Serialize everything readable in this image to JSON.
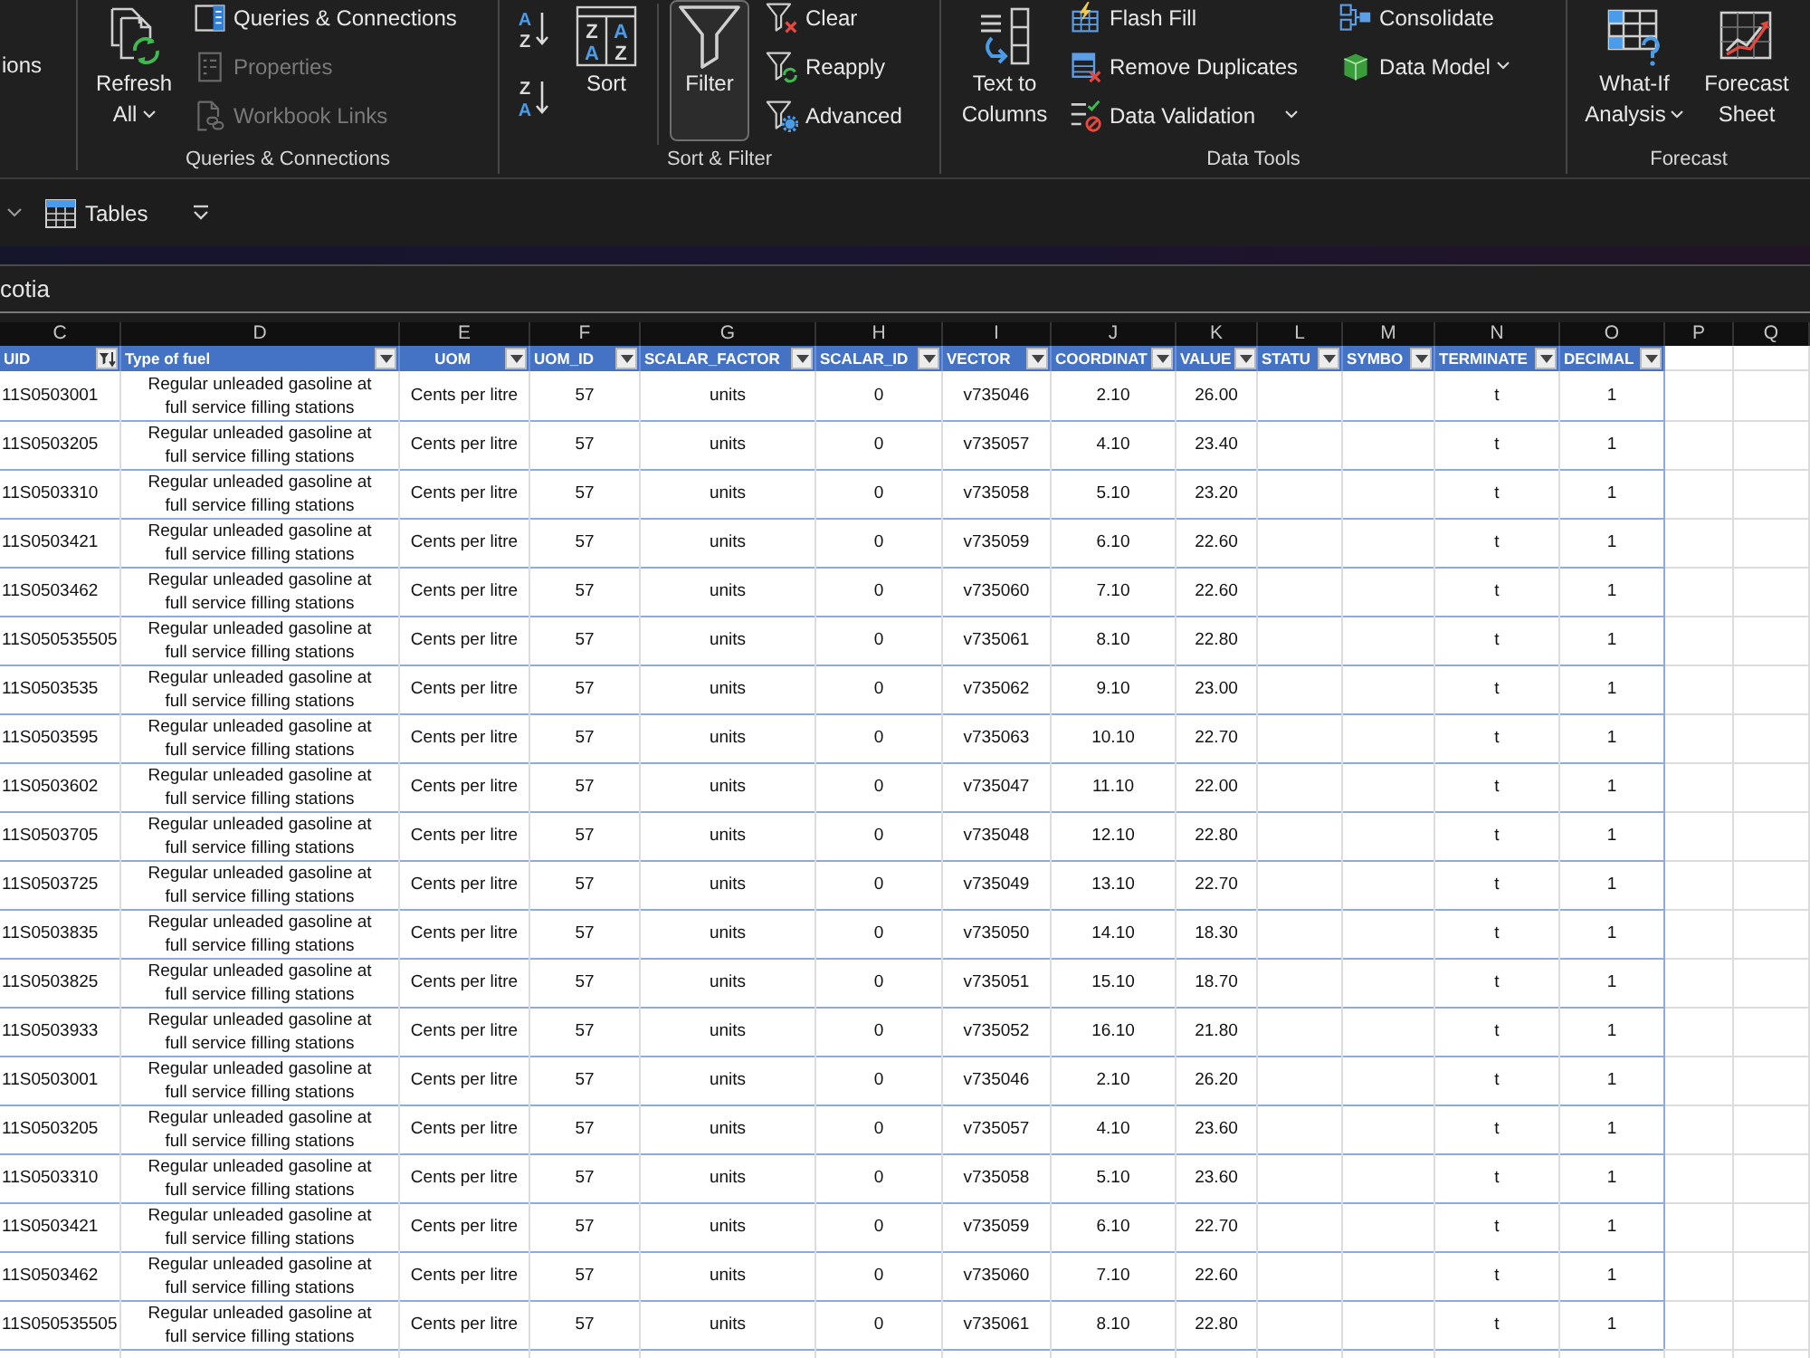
{
  "ribbon": {
    "cut_button": {
      "label": "ions"
    },
    "groups": [
      {
        "label": "Queries & Connections",
        "columns": [
          {
            "kind": "large",
            "buttons": [
              {
                "label": "Refresh All",
                "dropdown": true,
                "on": false
              }
            ]
          },
          {
            "kind": "stack",
            "buttons": [
              {
                "label": "Queries & Connections",
                "dropdown": false,
                "disabled": false
              },
              {
                "label": "Properties",
                "dropdown": false,
                "disabled": true
              },
              {
                "label": "Workbook Links",
                "dropdown": false,
                "disabled": true
              }
            ]
          }
        ]
      },
      {
        "label": "Sort & Filter",
        "columns": [
          {
            "kind": "icons",
            "buttons": [
              {
                "letters": [
                  "A",
                  "Z"
                ]
              },
              {
                "letters": [
                  "Z",
                  "A"
                ]
              }
            ]
          },
          {
            "kind": "large",
            "buttons": [
              {
                "label": "Sort",
                "letters": [
                  "Z",
                  "A",
                  "A",
                  "Z"
                ],
                "dropdown": false,
                "on": false
              }
            ]
          },
          {
            "kind": "large",
            "buttons": [
              {
                "label": "Filter",
                "dropdown": false,
                "on": true
              }
            ]
          },
          {
            "kind": "stack",
            "buttons": [
              {
                "label": "Clear",
                "dropdown": false,
                "disabled": false
              },
              {
                "label": "Reapply",
                "dropdown": false,
                "disabled": false
              },
              {
                "label": "Advanced",
                "dropdown": false,
                "disabled": false
              }
            ]
          }
        ]
      },
      {
        "label": "Data Tools",
        "columns": [
          {
            "kind": "large",
            "buttons": [
              {
                "label": "Text to Columns",
                "dropdown": false,
                "on": false
              }
            ]
          },
          {
            "kind": "stack",
            "buttons": [
              {
                "label": "Flash Fill",
                "dropdown": false,
                "disabled": false
              },
              {
                "label": "Remove Duplicates",
                "dropdown": false,
                "disabled": false
              },
              {
                "label": "Data Validation",
                "dropdown": true,
                "disabled": false
              }
            ]
          },
          {
            "kind": "stack",
            "buttons": [
              {
                "label": "Consolidate",
                "dropdown": false,
                "disabled": false
              },
              {
                "label": "Data Model",
                "dropdown": true,
                "disabled": false
              }
            ]
          }
        ]
      },
      {
        "label": "Forecast",
        "columns": [
          {
            "kind": "large",
            "buttons": [
              {
                "label": "What-If Analysis",
                "dropdown": true,
                "on": false
              },
              {
                "label": "Forecast Sheet",
                "dropdown": false,
                "on": false
              }
            ]
          }
        ]
      }
    ]
  },
  "toolbar": {
    "tables_button": {
      "label": "Tables"
    }
  },
  "formula_bar": {
    "value": "cotia"
  },
  "sheet": {
    "column_letters": [
      "C",
      "D",
      "E",
      "F",
      "G",
      "H",
      "I",
      "J",
      "K",
      "L",
      "M",
      "N",
      "O",
      "P",
      "Q"
    ],
    "table": {
      "columns": [
        {
          "heading": "UID",
          "filter_applied": true
        },
        {
          "heading": "Type of fuel",
          "filter_applied": false
        },
        {
          "heading": "UOM",
          "filter_applied": false
        },
        {
          "heading": "UOM_ID",
          "filter_applied": false
        },
        {
          "heading": "SCALAR_FACTOR",
          "filter_applied": false
        },
        {
          "heading": "SCALAR_ID",
          "filter_applied": false
        },
        {
          "heading": "VECTOR",
          "filter_applied": false
        },
        {
          "heading": "COORDINAT",
          "filter_applied": false
        },
        {
          "heading": "VALUE",
          "filter_applied": false
        },
        {
          "heading": "STATU",
          "filter_applied": false
        },
        {
          "heading": "SYMBO",
          "filter_applied": false
        },
        {
          "heading": "TERMINATE",
          "filter_applied": false
        },
        {
          "heading": "DECIMAL",
          "filter_applied": false
        }
      ],
      "rows": [
        {
          "uid": "11S0503001",
          "type_of_fuel": "Regular unleaded gasoline at full service filling stations",
          "uom": "Cents per litre",
          "uom_id": "57",
          "scalar_factor": "units",
          "scalar_id": "0",
          "vector": "v735046",
          "coordinate": "2.10",
          "value": "26.00",
          "terminated": "t",
          "decimals": "1"
        },
        {
          "uid": "11S0503205",
          "type_of_fuel": "Regular unleaded gasoline at full service filling stations",
          "uom": "Cents per litre",
          "uom_id": "57",
          "scalar_factor": "units",
          "scalar_id": "0",
          "vector": "v735057",
          "coordinate": "4.10",
          "value": "23.40",
          "terminated": "t",
          "decimals": "1"
        },
        {
          "uid": "11S0503310",
          "type_of_fuel": "Regular unleaded gasoline at full service filling stations",
          "uom": "Cents per litre",
          "uom_id": "57",
          "scalar_factor": "units",
          "scalar_id": "0",
          "vector": "v735058",
          "coordinate": "5.10",
          "value": "23.20",
          "terminated": "t",
          "decimals": "1"
        },
        {
          "uid": "11S0503421",
          "type_of_fuel": "Regular unleaded gasoline at full service filling stations",
          "uom": "Cents per litre",
          "uom_id": "57",
          "scalar_factor": "units",
          "scalar_id": "0",
          "vector": "v735059",
          "coordinate": "6.10",
          "value": "22.60",
          "terminated": "t",
          "decimals": "1"
        },
        {
          "uid": "11S0503462",
          "type_of_fuel": "Regular unleaded gasoline at full service filling stations",
          "uom": "Cents per litre",
          "uom_id": "57",
          "scalar_factor": "units",
          "scalar_id": "0",
          "vector": "v735060",
          "coordinate": "7.10",
          "value": "22.60",
          "terminated": "t",
          "decimals": "1"
        },
        {
          "uid": "11S050535505",
          "type_of_fuel": "Regular unleaded gasoline at full service filling stations",
          "uom": "Cents per litre",
          "uom_id": "57",
          "scalar_factor": "units",
          "scalar_id": "0",
          "vector": "v735061",
          "coordinate": "8.10",
          "value": "22.80",
          "terminated": "t",
          "decimals": "1"
        },
        {
          "uid": "11S0503535",
          "type_of_fuel": "Regular unleaded gasoline at full service filling stations",
          "uom": "Cents per litre",
          "uom_id": "57",
          "scalar_factor": "units",
          "scalar_id": "0",
          "vector": "v735062",
          "coordinate": "9.10",
          "value": "23.00",
          "terminated": "t",
          "decimals": "1"
        },
        {
          "uid": "11S0503595",
          "type_of_fuel": "Regular unleaded gasoline at full service filling stations",
          "uom": "Cents per litre",
          "uom_id": "57",
          "scalar_factor": "units",
          "scalar_id": "0",
          "vector": "v735063",
          "coordinate": "10.10",
          "value": "22.70",
          "terminated": "t",
          "decimals": "1"
        },
        {
          "uid": "11S0503602",
          "type_of_fuel": "Regular unleaded gasoline at full service filling stations",
          "uom": "Cents per litre",
          "uom_id": "57",
          "scalar_factor": "units",
          "scalar_id": "0",
          "vector": "v735047",
          "coordinate": "11.10",
          "value": "22.00",
          "terminated": "t",
          "decimals": "1"
        },
        {
          "uid": "11S0503705",
          "type_of_fuel": "Regular unleaded gasoline at full service filling stations",
          "uom": "Cents per litre",
          "uom_id": "57",
          "scalar_factor": "units",
          "scalar_id": "0",
          "vector": "v735048",
          "coordinate": "12.10",
          "value": "22.80",
          "terminated": "t",
          "decimals": "1"
        },
        {
          "uid": "11S0503725",
          "type_of_fuel": "Regular unleaded gasoline at full service filling stations",
          "uom": "Cents per litre",
          "uom_id": "57",
          "scalar_factor": "units",
          "scalar_id": "0",
          "vector": "v735049",
          "coordinate": "13.10",
          "value": "22.70",
          "terminated": "t",
          "decimals": "1"
        },
        {
          "uid": "11S0503835",
          "type_of_fuel": "Regular unleaded gasoline at full service filling stations",
          "uom": "Cents per litre",
          "uom_id": "57",
          "scalar_factor": "units",
          "scalar_id": "0",
          "vector": "v735050",
          "coordinate": "14.10",
          "value": "18.30",
          "terminated": "t",
          "decimals": "1"
        },
        {
          "uid": "11S0503825",
          "type_of_fuel": "Regular unleaded gasoline at full service filling stations",
          "uom": "Cents per litre",
          "uom_id": "57",
          "scalar_factor": "units",
          "scalar_id": "0",
          "vector": "v735051",
          "coordinate": "15.10",
          "value": "18.70",
          "terminated": "t",
          "decimals": "1"
        },
        {
          "uid": "11S0503933",
          "type_of_fuel": "Regular unleaded gasoline at full service filling stations",
          "uom": "Cents per litre",
          "uom_id": "57",
          "scalar_factor": "units",
          "scalar_id": "0",
          "vector": "v735052",
          "coordinate": "16.10",
          "value": "21.80",
          "terminated": "t",
          "decimals": "1"
        },
        {
          "uid": "11S0503001",
          "type_of_fuel": "Regular unleaded gasoline at full service filling stations",
          "uom": "Cents per litre",
          "uom_id": "57",
          "scalar_factor": "units",
          "scalar_id": "0",
          "vector": "v735046",
          "coordinate": "2.10",
          "value": "26.20",
          "terminated": "t",
          "decimals": "1"
        },
        {
          "uid": "11S0503205",
          "type_of_fuel": "Regular unleaded gasoline at full service filling stations",
          "uom": "Cents per litre",
          "uom_id": "57",
          "scalar_factor": "units",
          "scalar_id": "0",
          "vector": "v735057",
          "coordinate": "4.10",
          "value": "23.60",
          "terminated": "t",
          "decimals": "1"
        },
        {
          "uid": "11S0503310",
          "type_of_fuel": "Regular unleaded gasoline at full service filling stations",
          "uom": "Cents per litre",
          "uom_id": "57",
          "scalar_factor": "units",
          "scalar_id": "0",
          "vector": "v735058",
          "coordinate": "5.10",
          "value": "23.60",
          "terminated": "t",
          "decimals": "1"
        },
        {
          "uid": "11S0503421",
          "type_of_fuel": "Regular unleaded gasoline at full service filling stations",
          "uom": "Cents per litre",
          "uom_id": "57",
          "scalar_factor": "units",
          "scalar_id": "0",
          "vector": "v735059",
          "coordinate": "6.10",
          "value": "22.70",
          "terminated": "t",
          "decimals": "1"
        },
        {
          "uid": "11S0503462",
          "type_of_fuel": "Regular unleaded gasoline at full service filling stations",
          "uom": "Cents per litre",
          "uom_id": "57",
          "scalar_factor": "units",
          "scalar_id": "0",
          "vector": "v735060",
          "coordinate": "7.10",
          "value": "22.60",
          "terminated": "t",
          "decimals": "1"
        },
        {
          "uid": "11S050535505",
          "type_of_fuel": "Regular unleaded gasoline at full service filling stations",
          "uom": "Cents per litre",
          "uom_id": "57",
          "scalar_factor": "units",
          "scalar_id": "0",
          "vector": "v735061",
          "coordinate": "8.10",
          "value": "22.80",
          "terminated": "t",
          "decimals": "1"
        }
      ]
    }
  }
}
